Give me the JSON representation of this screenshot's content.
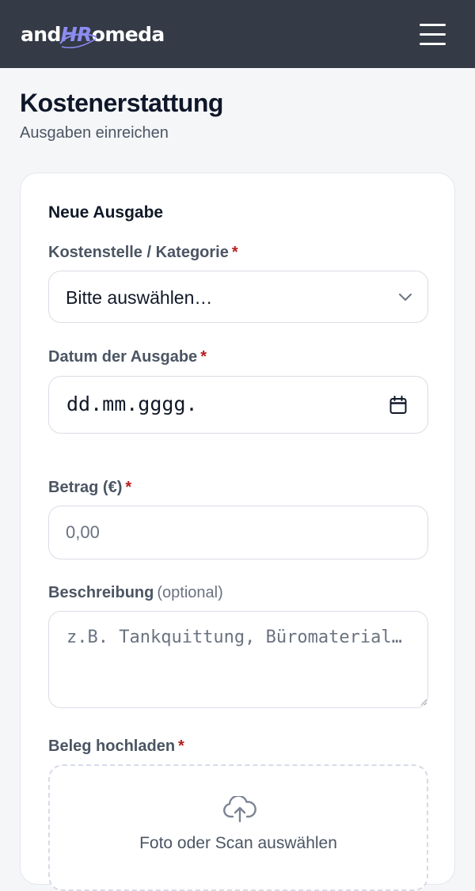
{
  "header": {
    "logo_prefix": "and",
    "logo_highlight": "HR",
    "logo_suffix": "omeda",
    "menu_icon": "hamburger-menu-icon"
  },
  "page": {
    "title": "Kostenerstattung",
    "subtitle": "Ausgaben einreichen"
  },
  "form": {
    "section_title": "Neue Ausgabe",
    "required_marker": "*",
    "category": {
      "label": "Kostenstelle / Kategorie",
      "selected": "Bitte auswählen…",
      "icon": "chevron-down-icon"
    },
    "date": {
      "label": "Datum der Ausgabe",
      "placeholder": "dd.mm.gggg.",
      "icon": "calendar-icon"
    },
    "amount": {
      "label": "Betrag (€)",
      "placeholder": "0,00"
    },
    "description": {
      "label": "Beschreibung",
      "optional_hint": "(optional)",
      "placeholder": "z.B. Tankquittung, Büromaterial…"
    },
    "receipt": {
      "label": "Beleg hochladen",
      "dropzone_text": "Foto oder Scan auswählen",
      "icon": "cloud-upload-icon"
    }
  },
  "colors": {
    "topbar": "#343a46",
    "logo_accent": "#8c8cf0",
    "required": "#b91c1c",
    "label": "#4b5563",
    "border": "#d9dde5",
    "background": "#f5f6f8"
  }
}
